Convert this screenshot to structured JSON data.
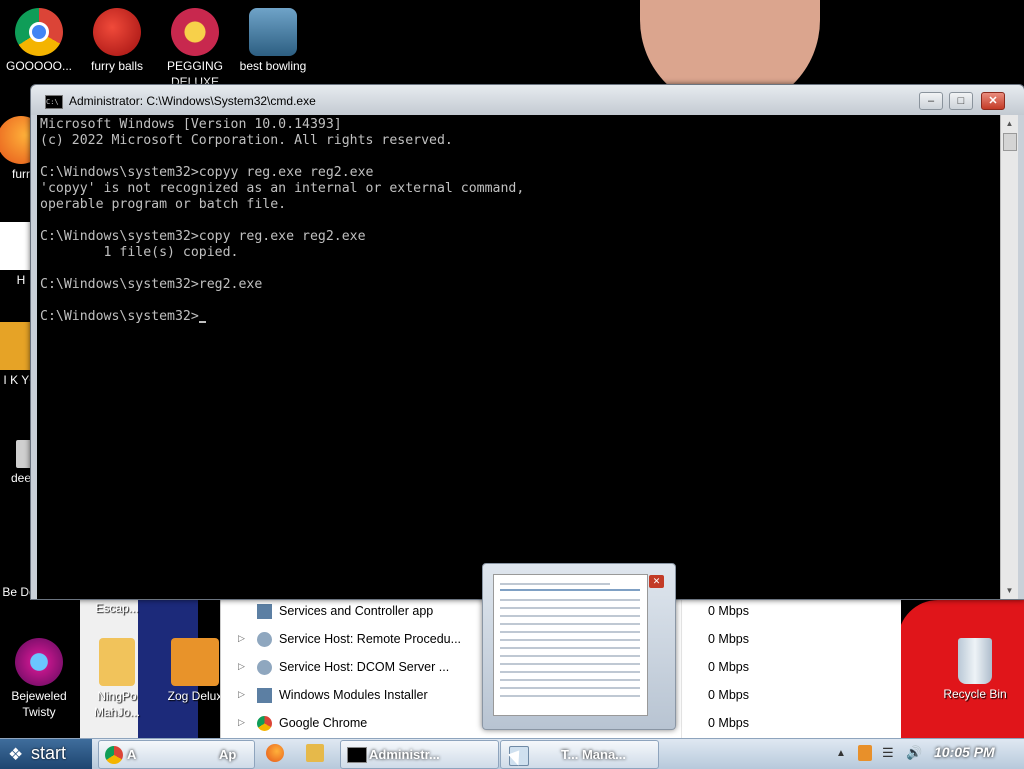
{
  "desktop": {
    "icons": [
      {
        "label": "GOOOOO...",
        "icon": "chrome-icon"
      },
      {
        "label": "furry balls",
        "icon": "furry-balls-icon"
      },
      {
        "label": "PEGGING DELUXE",
        "icon": "pegging-icon"
      },
      {
        "label": "best bowling",
        "icon": "bowling-icon"
      },
      {
        "label": "furr",
        "icon": "firefox-icon"
      },
      {
        "label": "H",
        "icon": "h-app-icon"
      },
      {
        "label": "I K YO",
        "icon": "folder-icon"
      },
      {
        "label": "dee",
        "icon": "app-icon"
      },
      {
        "label": "Be Deluxe",
        "icon": "game-icon"
      },
      {
        "label": "Escap...",
        "icon": "escape-icon"
      },
      {
        "label": "Bejeweled Twisty",
        "icon": "bejeweled-icon"
      },
      {
        "label": "NingPo MahJo...",
        "icon": "ningpo-icon"
      },
      {
        "label": "Zog Delux",
        "icon": "zog-icon"
      },
      {
        "label": "Recycle Bin",
        "icon": "recycle-bin-icon"
      }
    ]
  },
  "cmd_window": {
    "title": "Administrator: C:\\Windows\\System32\\cmd.exe",
    "icon_text": "C:\\",
    "minimize": "–",
    "maximize": "□",
    "close": "✕",
    "lines": [
      "Microsoft Windows [Version 10.0.14393]",
      "(c) 2022 Microsoft Corporation. All rights reserved.",
      "",
      "C:\\Windows\\system32>copyy reg.exe reg2.exe",
      "'copyy' is not recognized as an internal or external command,",
      "operable program or batch file.",
      "",
      "C:\\Windows\\system32>copy reg.exe reg2.exe",
      "        1 file(s) copied.",
      "",
      "C:\\Windows\\system32>reg2.exe",
      "",
      "C:\\Windows\\system32>"
    ]
  },
  "task_manager_rows": [
    {
      "name": "Services and Controller app",
      "net": "0 Mbps",
      "expand": false
    },
    {
      "name": "Service Host: Remote Procedu...",
      "net": "0 Mbps",
      "expand": true
    },
    {
      "name": "Service Host: DCOM Server ...",
      "net": "0 Mbps",
      "expand": true
    },
    {
      "name": "Windows Modules Installer",
      "net": "0 Mbps",
      "expand": true
    },
    {
      "name": "Google Chrome",
      "net": "0 Mbps",
      "expand": true
    }
  ],
  "thumbnail": {
    "close": "✕"
  },
  "taskbar": {
    "start_label": "start",
    "start_flag": "❖",
    "buttons": [
      {
        "label": "A",
        "icon": "chrome-icon"
      },
      {
        "label": "Ap",
        "icon": "app-icon"
      },
      {
        "label": "Administr...",
        "icon": "cmd-icon"
      },
      {
        "label": "T... Mana...",
        "icon": "task-manager-icon"
      }
    ],
    "tray": {
      "up_arrow": "▲",
      "volume": "🔊",
      "network": "☰"
    },
    "clock": "10:05 PM"
  },
  "colors": {
    "console_bg": "#000000",
    "console_fg": "#c0c0c0",
    "close_red": "#c33b27"
  }
}
